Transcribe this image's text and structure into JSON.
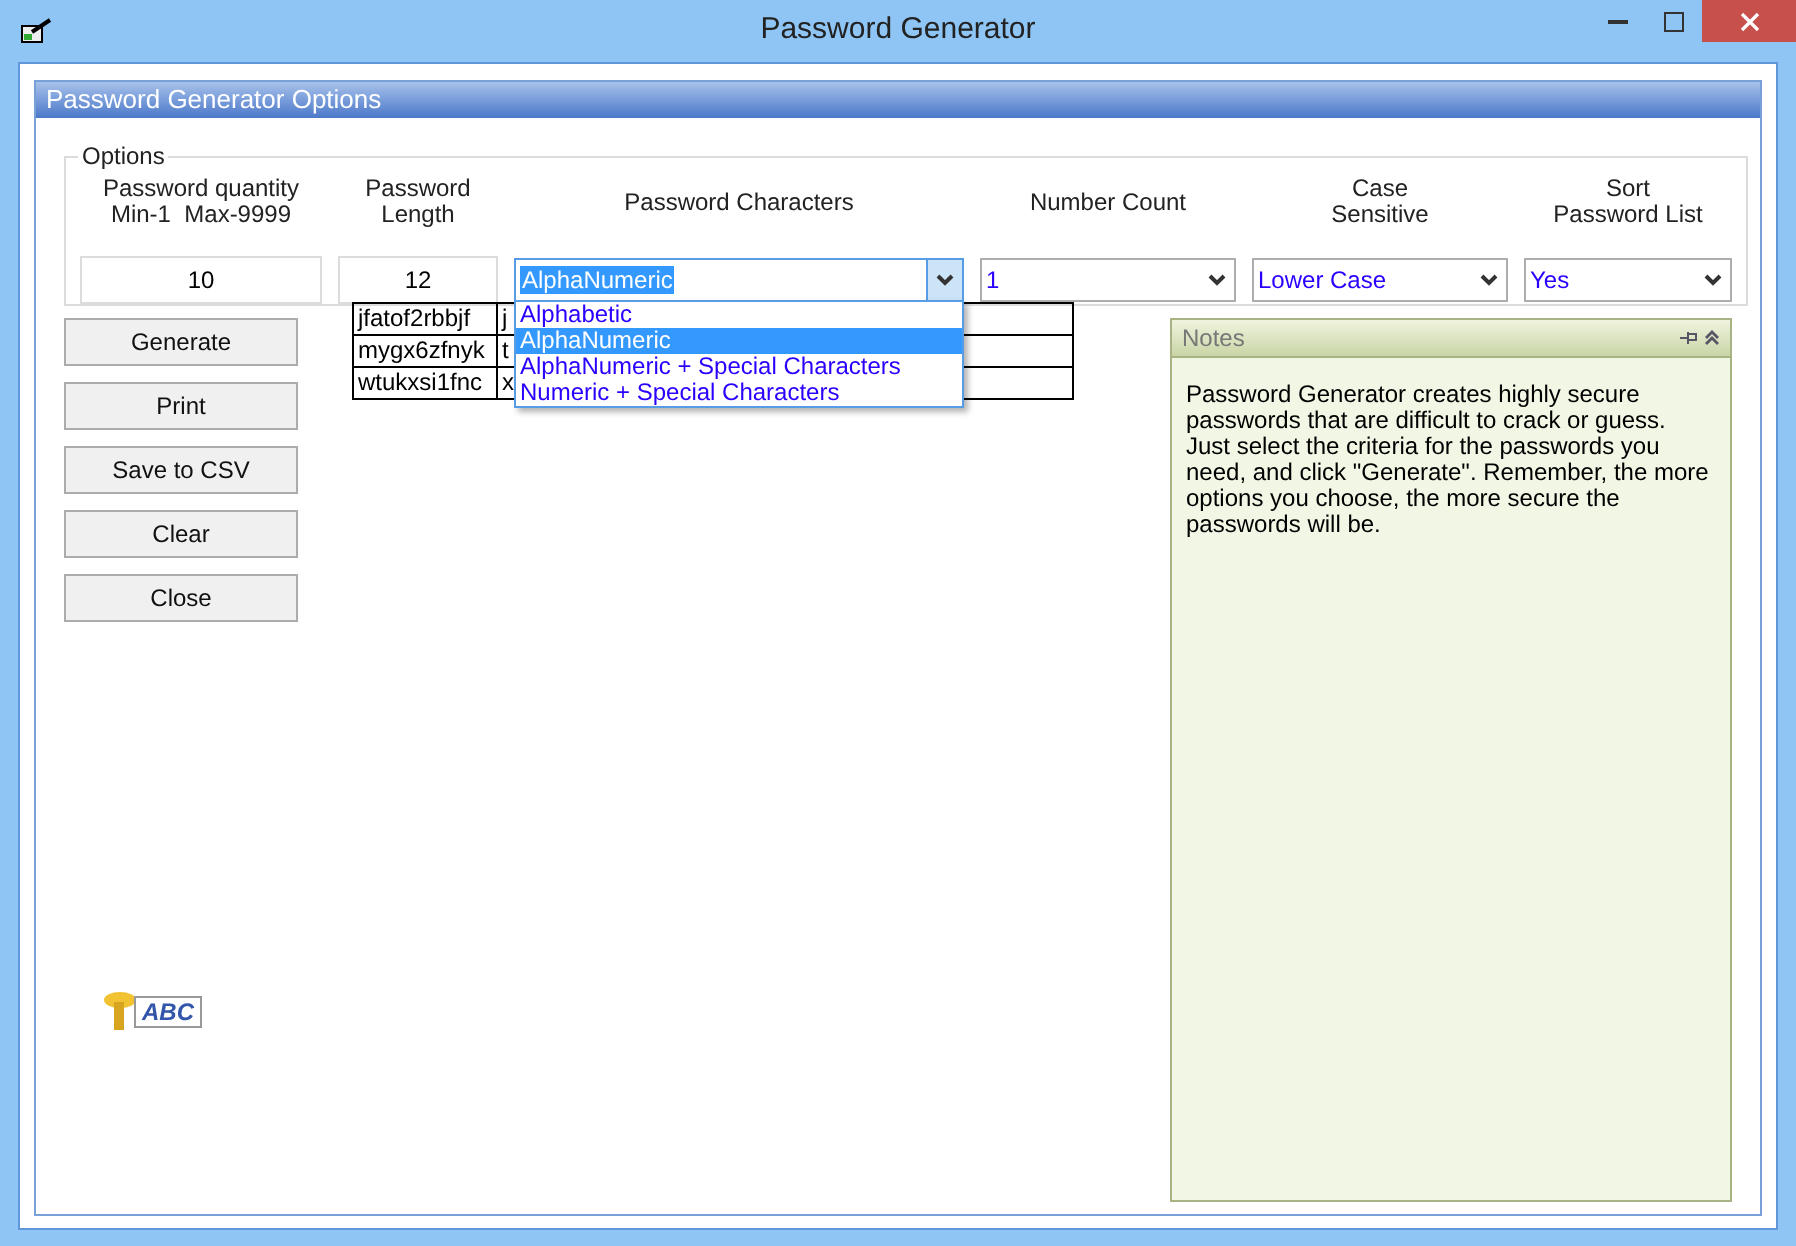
{
  "window": {
    "title": "Password Generator"
  },
  "panel": {
    "title": "Password Generator Options"
  },
  "options": {
    "legend": "Options",
    "quantity": {
      "label": [
        "Password quantity",
        "Min-1  Max-9999"
      ],
      "value": "10"
    },
    "length": {
      "label": [
        "Password",
        "Length"
      ],
      "value": "12"
    },
    "characters": {
      "label": [
        "Password Characters"
      ],
      "value": "AlphaNumeric",
      "expanded": true,
      "items": [
        {
          "label": "Alphabetic",
          "selected": false
        },
        {
          "label": "AlphaNumeric",
          "selected": true
        },
        {
          "label": "AlphaNumeric + Special Characters",
          "selected": false
        },
        {
          "label": "Numeric + Special Characters",
          "selected": false
        }
      ]
    },
    "number_count": {
      "label": [
        "Number Count"
      ],
      "value": "1"
    },
    "case": {
      "label": [
        "Case",
        "Sensitive"
      ],
      "value": "Lower Case"
    },
    "sort": {
      "label": [
        "Sort",
        "Password List"
      ],
      "value": "Yes"
    }
  },
  "buttons": [
    "Generate",
    "Print",
    "Save to CSV",
    "Clear",
    "Close"
  ],
  "table": {
    "rows": [
      [
        "jfatof2rbbjf",
        "j",
        "",
        "",
        ""
      ],
      [
        "mygx6zfnyk",
        "t",
        "",
        "",
        ""
      ],
      [
        "wtukxsi1fnc",
        "x",
        "",
        "",
        ""
      ]
    ]
  },
  "notes": {
    "title": "Notes",
    "text": "Password Generator creates highly secure passwords that are difficult to crack or guess. Just select the criteria for the passwords you need, and click \"Generate\". Remember, the more options you choose, the more secure the passwords will be."
  },
  "logo": {
    "text": "ABC"
  }
}
